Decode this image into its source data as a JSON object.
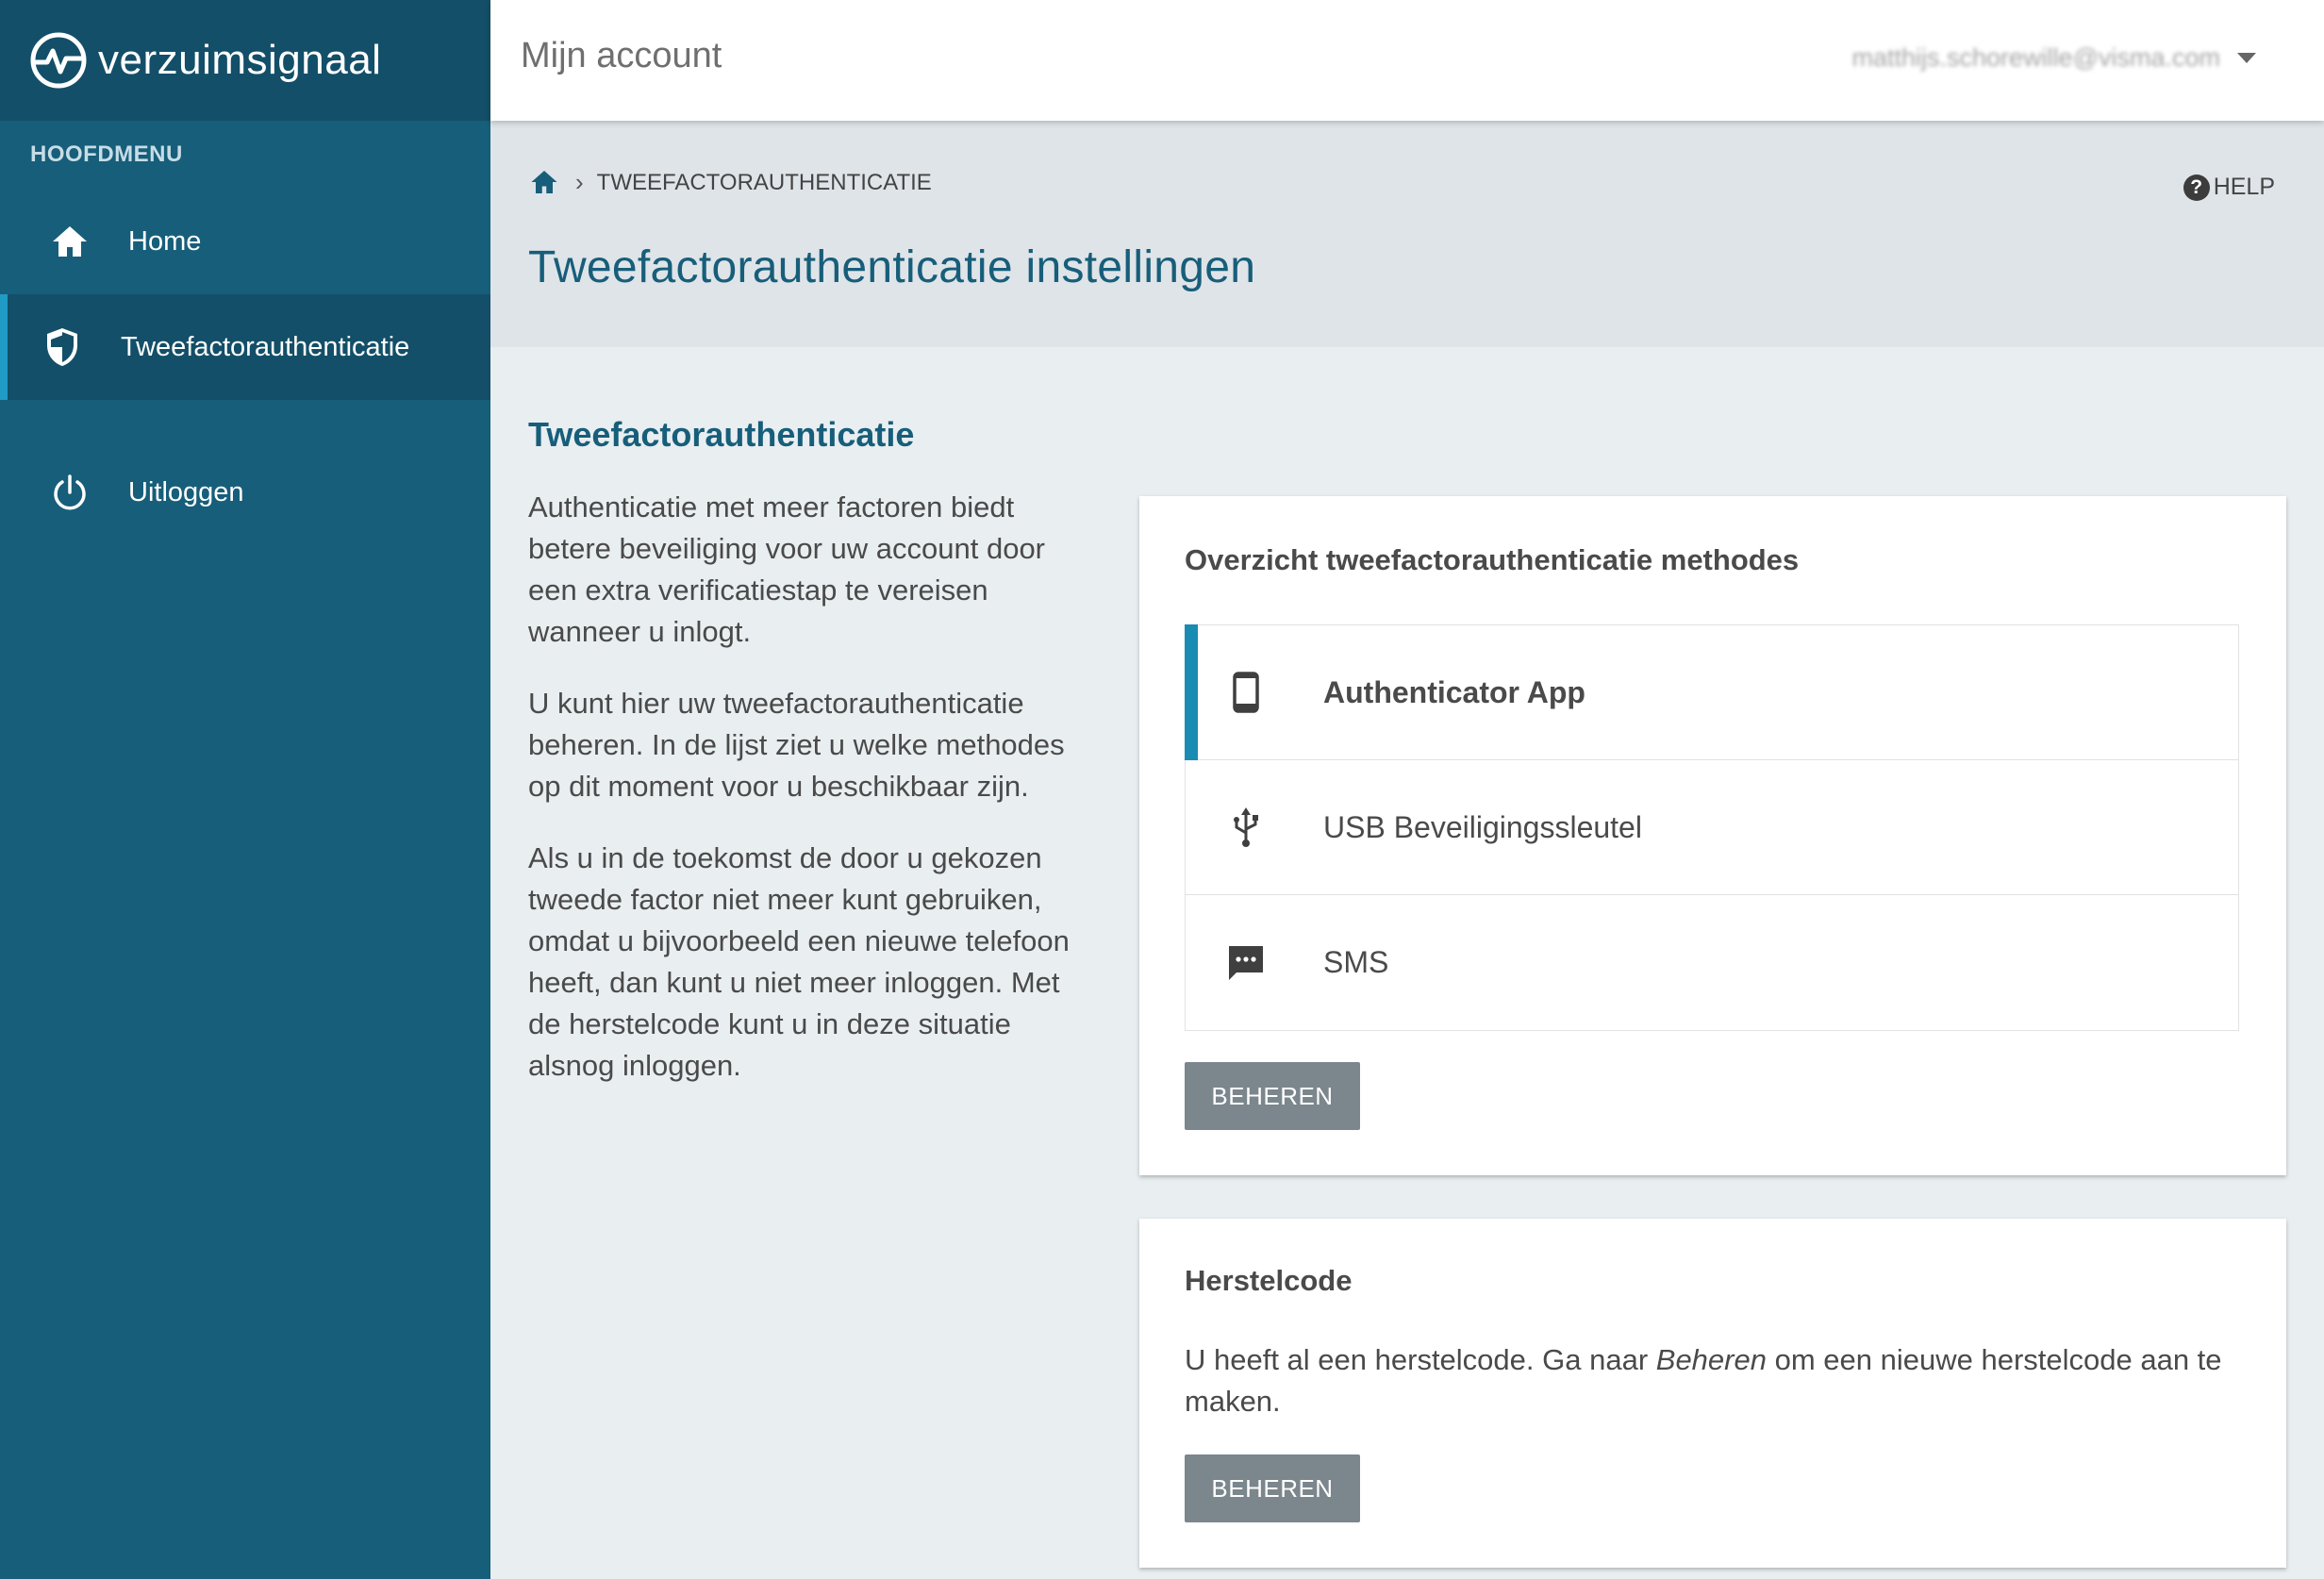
{
  "brand": {
    "name": "verzuimsignaal",
    "logo_icon": "pulse-circle-icon"
  },
  "sidebar": {
    "heading": "HOOFDMENU",
    "items": [
      {
        "label": "Home",
        "icon": "home-icon",
        "active": false
      },
      {
        "label": "Tweefactorauthenticatie",
        "icon": "shield-icon",
        "active": true
      },
      {
        "label": "Uitloggen",
        "icon": "power-icon",
        "active": false
      }
    ]
  },
  "topbar": {
    "title": "Mijn account",
    "user_email": "matthijs.schorewille@visma.com"
  },
  "header": {
    "breadcrumb_current": "TWEEFACTORAUTHENTICATIE",
    "help_label": "HELP",
    "page_title": "Tweefactorauthenticatie instellingen"
  },
  "info": {
    "heading": "Tweefactorauthenticatie",
    "paragraphs": [
      "Authenticatie met meer factoren biedt betere beveiliging voor uw account door een extra verificatiestap te vereisen wanneer u inlogt.",
      "U kunt hier uw tweefactorauthenticatie beheren. In de lijst ziet u welke methodes op dit moment voor u beschikbaar zijn.",
      "Als u in de toekomst de door u gekozen tweede factor niet meer kunt gebruiken, omdat u bijvoorbeeld een nieuwe telefoon heeft, dan kunt u niet meer inloggen. Met de herstelcode kunt u in deze situatie alsnog inloggen."
    ]
  },
  "methods_card": {
    "title": "Overzicht tweefactorauthenticatie methodes",
    "methods": [
      {
        "label": "Authenticator App",
        "icon": "smartphone-icon",
        "selected": true
      },
      {
        "label": "USB Beveiligingssleutel",
        "icon": "usb-icon",
        "selected": false
      },
      {
        "label": "SMS",
        "icon": "sms-icon",
        "selected": false
      }
    ],
    "button_label": "BEHEREN"
  },
  "recovery_card": {
    "title": "Herstelcode",
    "text_before": "U heeft al een herstelcode. Ga naar ",
    "text_emphasis": "Beheren",
    "text_after": " om een nieuwe herstelcode aan te maken.",
    "button_label": "BEHEREN"
  },
  "colors": {
    "sidebar": "#175e7a",
    "sidebar_dark": "#134f68",
    "accent": "#1a8bb3",
    "title": "#175e7a",
    "button": "#7b868d"
  }
}
